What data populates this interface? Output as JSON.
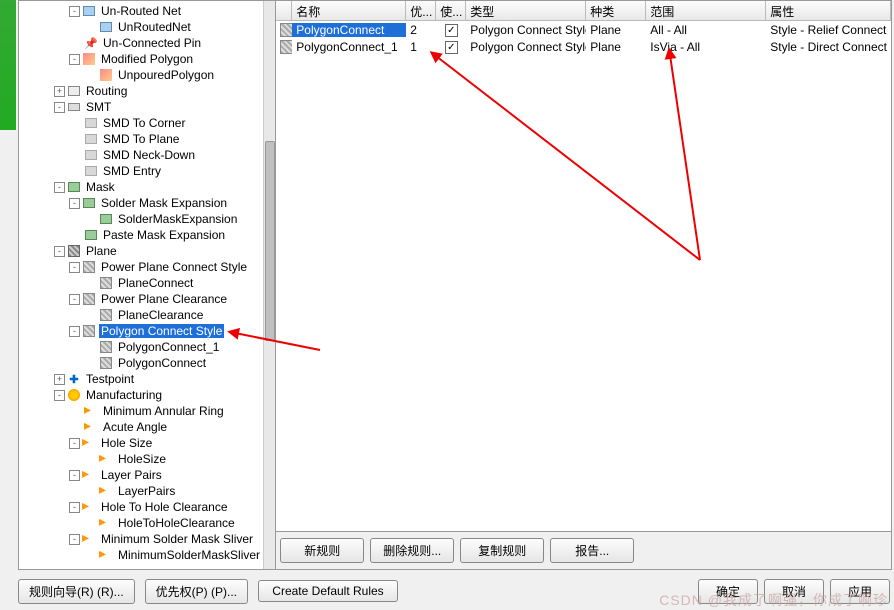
{
  "tree": {
    "unrouted_net": "Un-Routed Net",
    "unroutednet": "UnRoutedNet",
    "unconnected_pin": "Un-Connected Pin",
    "modified_polygon": "Modified Polygon",
    "unpoured_polygon": "UnpouredPolygon",
    "routing": "Routing",
    "smt": "SMT",
    "smd_corner": "SMD To Corner",
    "smd_plane": "SMD To Plane",
    "smd_neck": "SMD Neck-Down",
    "smd_entry": "SMD Entry",
    "mask": "Mask",
    "solder_mask_exp": "Solder Mask Expansion",
    "soldermaskexpansion": "SolderMaskExpansion",
    "paste_mask_exp": "Paste Mask Expansion",
    "plane": "Plane",
    "power_plane_connect": "Power Plane Connect Style",
    "planeconnect": "PlaneConnect",
    "power_plane_clearance": "Power Plane Clearance",
    "planeclearance": "PlaneClearance",
    "polygon_connect_style": "Polygon Connect Style",
    "polygonconnect_1": "PolygonConnect_1",
    "polygonconnect": "PolygonConnect",
    "testpoint": "Testpoint",
    "manufacturing": "Manufacturing",
    "min_annular": "Minimum Annular Ring",
    "acute_angle": "Acute Angle",
    "hole_size": "Hole Size",
    "holesize": "HoleSize",
    "layer_pairs": "Layer Pairs",
    "layerpairs": "LayerPairs",
    "hole_to_hole": "Hole To Hole Clearance",
    "holetoholeclearance": "HoleToHoleClearance",
    "min_solder_sliver": "Minimum Solder Mask Sliver",
    "minsoldermasksliver": "MinimumSolderMaskSliver"
  },
  "columns": {
    "name": "名称",
    "priority": "优...",
    "enable": "使...",
    "type": "类型",
    "kind": "种类",
    "scope": "范围",
    "attr": "属性"
  },
  "rows": [
    {
      "name": "PolygonConnect",
      "priority": "2",
      "enabled": true,
      "type": "Polygon Connect Style",
      "kind": "Plane",
      "scope": "All    -    All",
      "attr": "Style - Relief Connect"
    },
    {
      "name": "PolygonConnect_1",
      "priority": "1",
      "enabled": true,
      "type": "Polygon Connect Style",
      "kind": "Plane",
      "scope": "IsVia   -    All",
      "attr": "Style - Direct Connect"
    }
  ],
  "buttons": {
    "new_rule": "新规则",
    "delete_rule": "删除规则...",
    "copy_rule": "复制规则",
    "report": "报告..."
  },
  "bottom": {
    "wizard": "规则向导(R) (R)...",
    "priority": "优先权(P) (P)...",
    "defaults": "Create Default Rules",
    "ok": "确定",
    "cancel": "取消",
    "apply": "应用"
  },
  "watermark": "CSDN @我成了啊强，你成了啊珍"
}
